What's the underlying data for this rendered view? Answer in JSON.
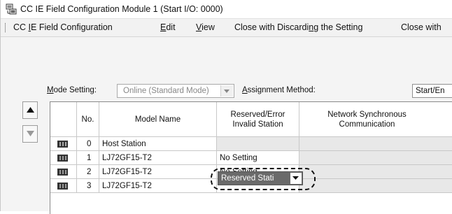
{
  "window": {
    "title": "CC IE Field Configuration Module 1 (Start I/O: 0000)"
  },
  "menu": {
    "items": [
      {
        "pre": "CC ",
        "u": "I",
        "post": "E Field Configuration"
      },
      {
        "pre": "",
        "u": "E",
        "post": "dit"
      },
      {
        "pre": "",
        "u": "V",
        "post": "iew"
      },
      {
        "pre": "Close with Discardi",
        "u": "n",
        "post": "g the Setting"
      },
      {
        "pre": "Close with",
        "u": "",
        "post": ""
      }
    ]
  },
  "settings": {
    "mode_label_u": "M",
    "mode_label_rest": "ode Setting:",
    "mode_value": "Online (Standard Mode)",
    "assign_label_u": "A",
    "assign_label_rest": "ssignment Method:",
    "assign_value": "Start/En"
  },
  "table": {
    "headers": {
      "no": "No.",
      "model": "Model Name",
      "reserved_line1": "Reserved/Error",
      "reserved_line2": "Invalid Station",
      "sync_line1": "Network Synchronous",
      "sync_line2": "Communication"
    },
    "rows": [
      {
        "no": "0",
        "model": "Host Station",
        "reserved": ""
      },
      {
        "no": "1",
        "model": "LJ72GF15-T2",
        "reserved": "No Setting"
      },
      {
        "no": "2",
        "model": "LJ72GF15-T2",
        "reserved": "No Setting"
      },
      {
        "no": "3",
        "model": "LJ72GF15-T2",
        "reserved": "Reserved Stati"
      }
    ]
  },
  "colors": {
    "selected_cell_bg": "#6a6a6a",
    "disabled_cell_bg": "#e8e8e8"
  }
}
